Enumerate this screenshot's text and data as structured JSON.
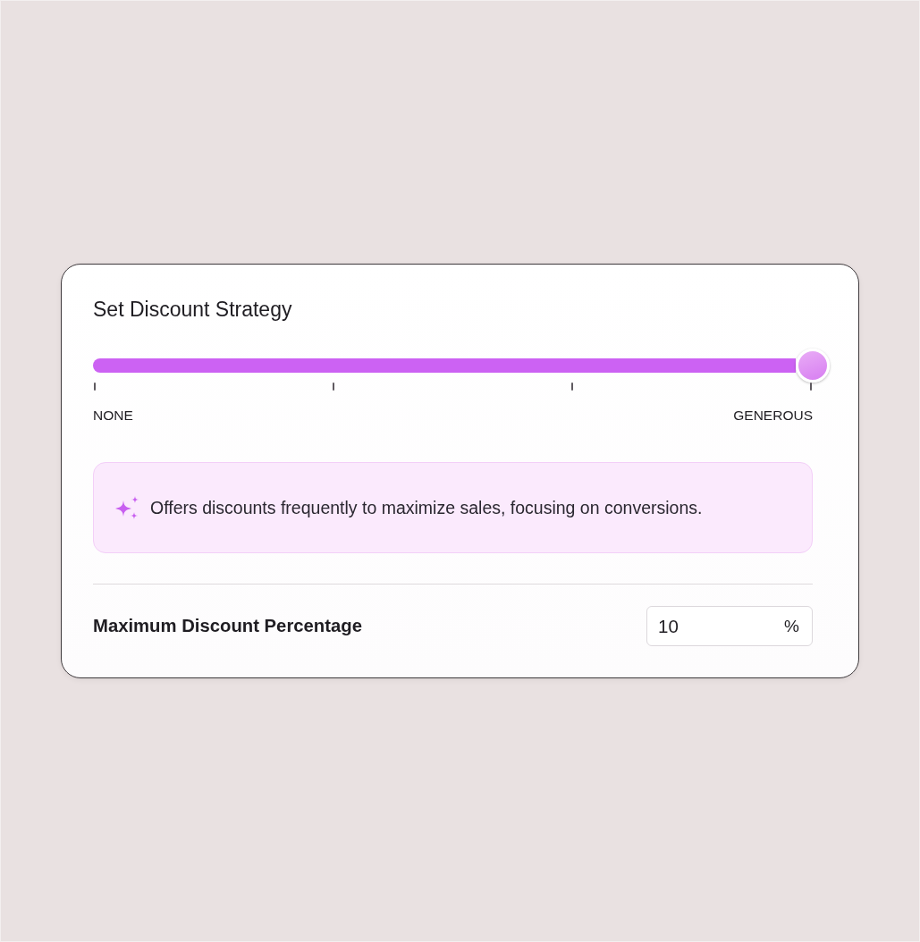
{
  "card": {
    "title": "Set Discount Strategy"
  },
  "slider": {
    "level": 1,
    "min_label": "NONE",
    "max_label": "GENEROUS"
  },
  "hint": {
    "text": "Offers discounts frequently to maximize sales, focusing on conversions."
  },
  "max_discount": {
    "label": "Maximum Discount Percentage",
    "value": "10",
    "unit": "%"
  }
}
